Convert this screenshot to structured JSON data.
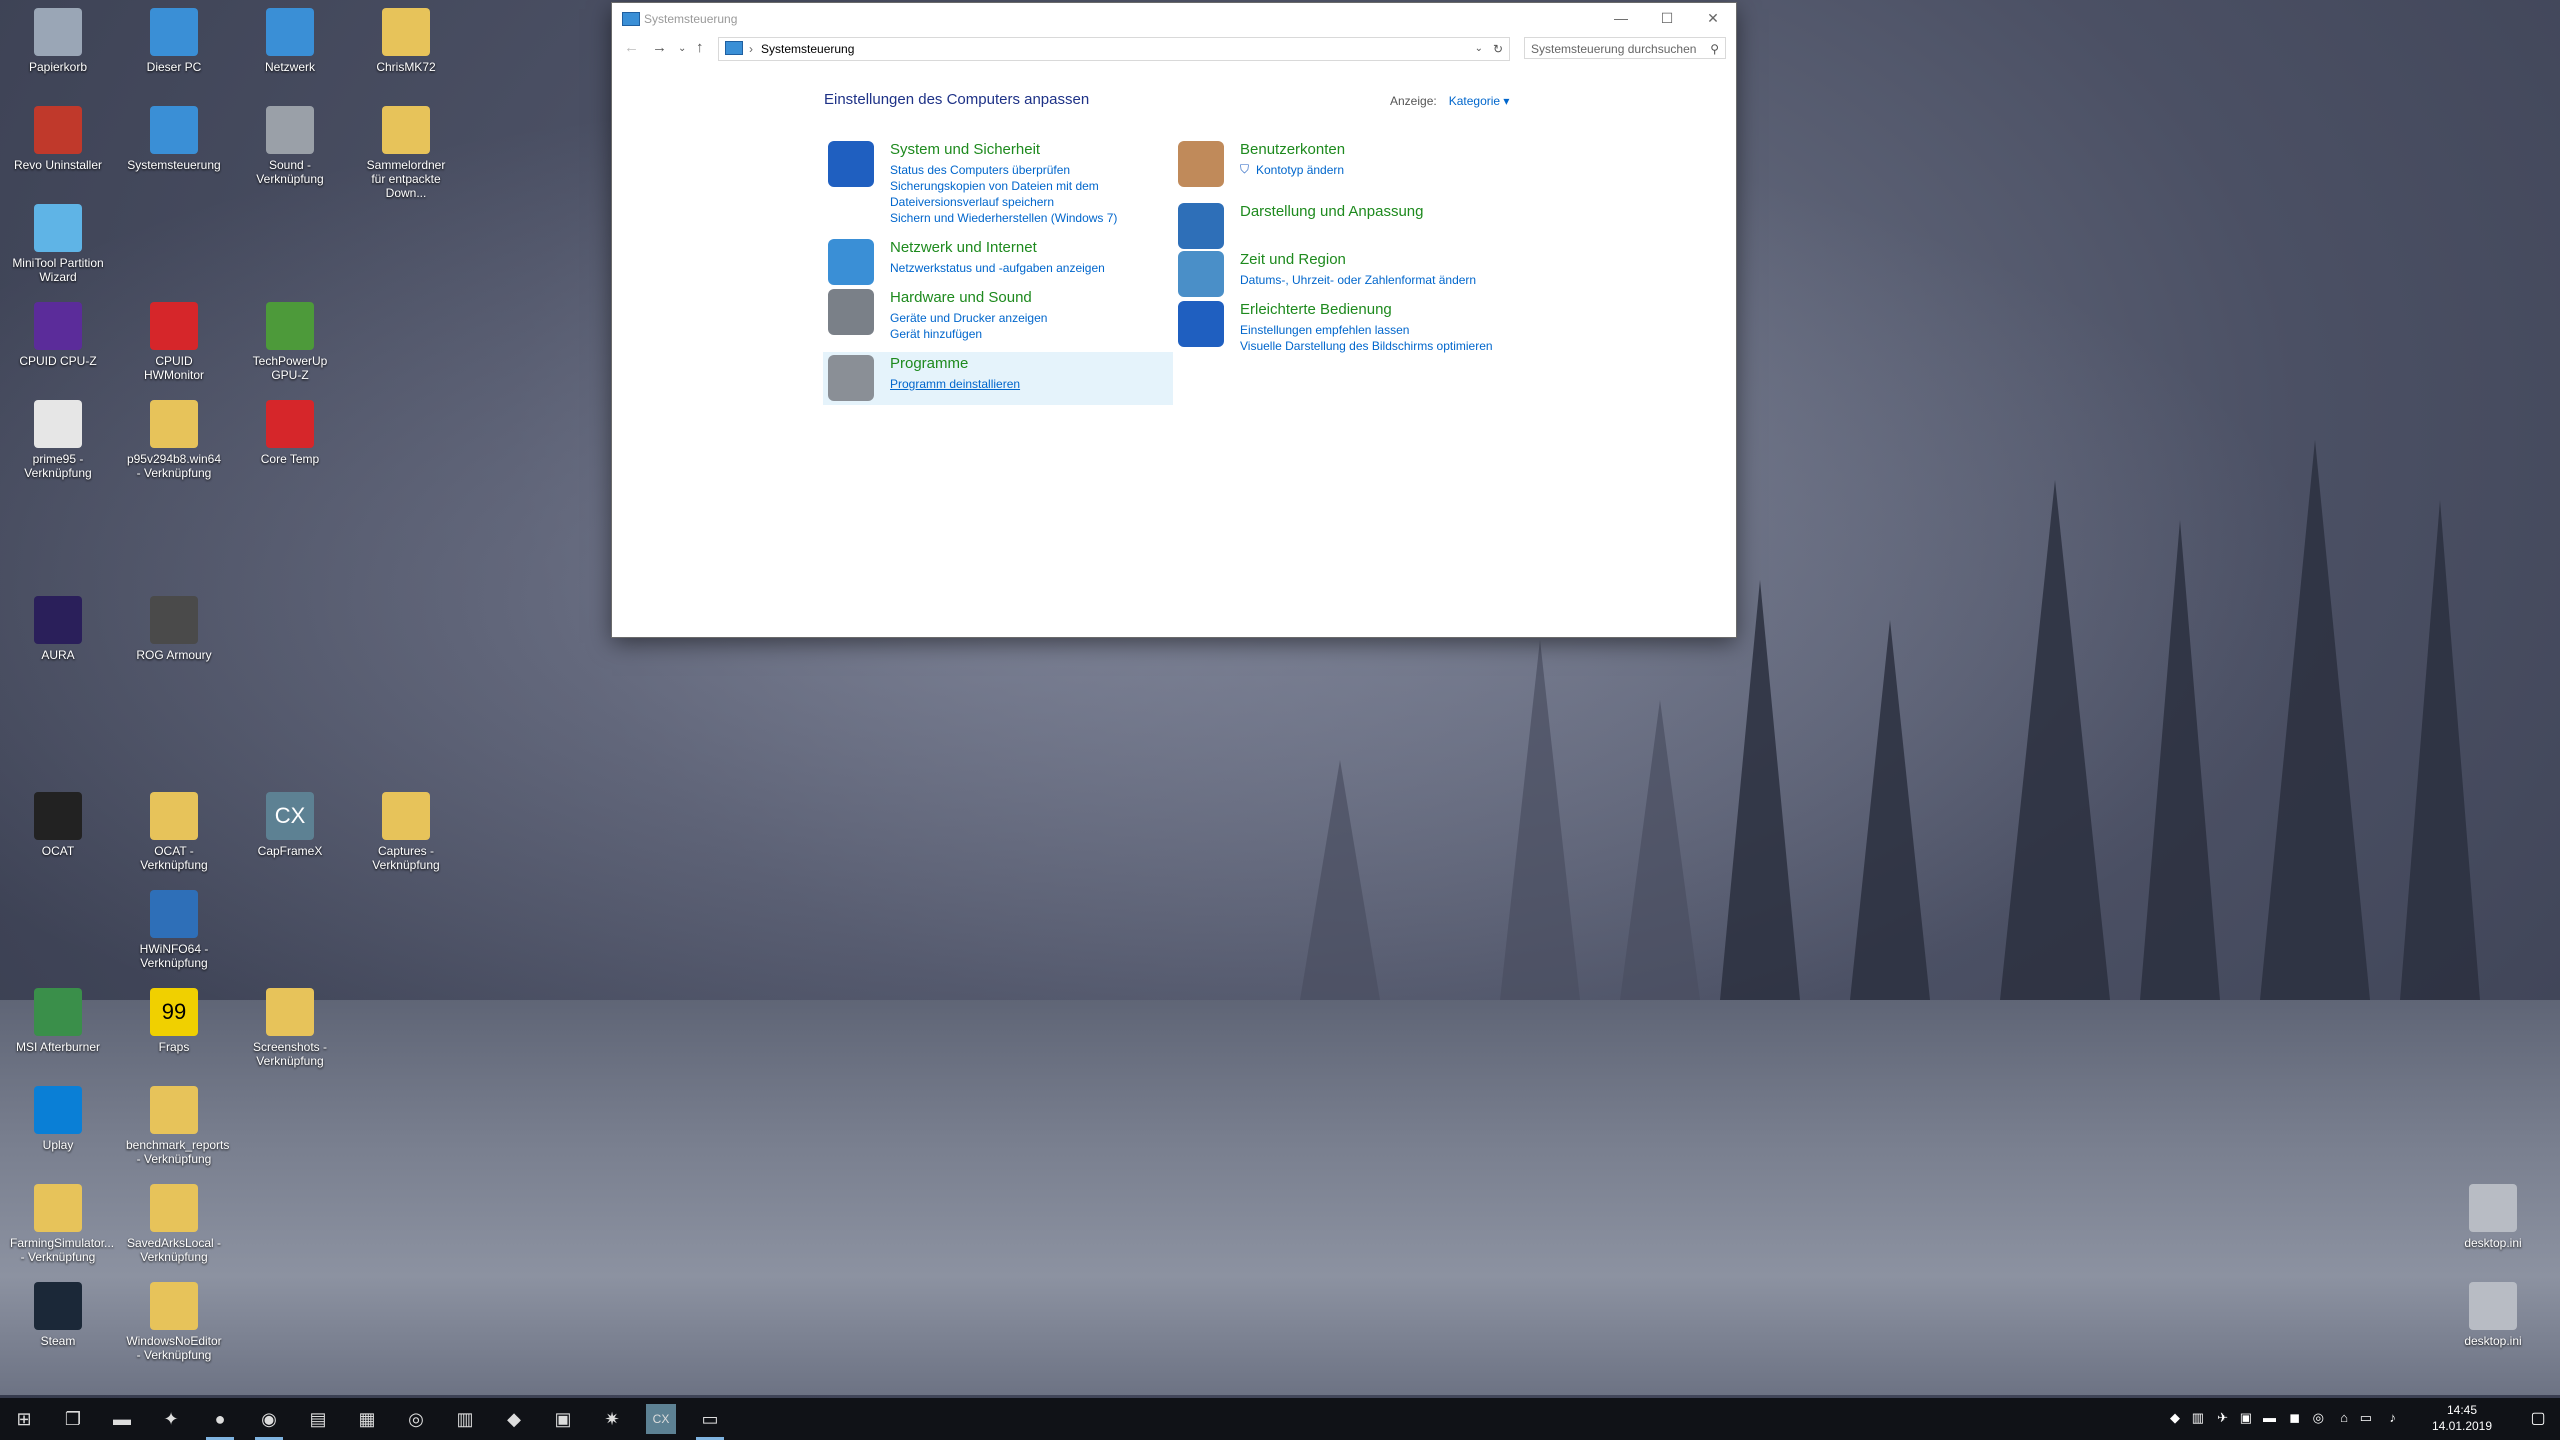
{
  "desktop": {
    "icons": [
      {
        "label": "Papierkorb",
        "icon": "recycle-bin-icon",
        "color": "#9aa6b6"
      },
      {
        "label": "Dieser PC",
        "icon": "computer-icon",
        "color": "#3a8fd6"
      },
      {
        "label": "Netzwerk",
        "icon": "network-icon",
        "color": "#3a8fd6"
      },
      {
        "label": "ChrisMK72",
        "icon": "user-folder-icon",
        "color": "#e7c35a"
      },
      {
        "label": "Revo Uninstaller",
        "icon": "revo-uninstaller-icon",
        "color": "#c0392b"
      },
      {
        "label": "Systemsteuerung",
        "icon": "control-panel-icon",
        "color": "#3a8fd6"
      },
      {
        "label": "Sound - Verknüpfung",
        "icon": "speaker-icon",
        "color": "#9aa0a8"
      },
      {
        "label": "Sammelordner für entpackte Down...",
        "icon": "folder-icon",
        "color": "#e7c35a"
      },
      {
        "label": "MiniTool Partition Wizard",
        "icon": "minitool-icon",
        "color": "#5fb4e6"
      },
      {
        "label": "CPUID CPU-Z",
        "icon": "cpuz-icon",
        "color": "#5b2c9a"
      },
      {
        "label": "CPUID HWMonitor",
        "icon": "hwmonitor-icon",
        "color": "#d6262a"
      },
      {
        "label": "TechPowerUp GPU-Z",
        "icon": "gpuz-icon",
        "color": "#4d9a3a"
      },
      {
        "label": "prime95 - Verknüpfung",
        "icon": "prime95-icon",
        "color": "#e6e6e6"
      },
      {
        "label": "p95v294b8.win64 - Verknüpfung",
        "icon": "folder-icon",
        "color": "#e7c35a"
      },
      {
        "label": "Core Temp",
        "icon": "core-temp-icon",
        "color": "#d6262a"
      },
      {
        "label": "AURA",
        "icon": "aura-icon",
        "color": "#2a1f5a"
      },
      {
        "label": "ROG Armoury",
        "icon": "rog-icon",
        "color": "#4a4a4a"
      },
      {
        "label": "OCAT",
        "icon": "ocat-icon",
        "color": "#222222"
      },
      {
        "label": "OCAT - Verknüpfung",
        "icon": "folder-icon",
        "color": "#e7c35a"
      },
      {
        "label": "CapFrameX",
        "icon": "capframex-icon",
        "color": "#5d8193",
        "text": "CX"
      },
      {
        "label": "Captures - Verknüpfung",
        "icon": "folder-icon",
        "color": "#e7c35a"
      },
      {
        "label": "HWiNFO64 - Verknüpfung",
        "icon": "hwinfo-icon",
        "color": "#2e6fb8"
      },
      {
        "label": "MSI Afterburner",
        "icon": "afterburner-icon",
        "color": "#3a8f4a"
      },
      {
        "label": "Fraps",
        "icon": "fraps-icon",
        "color": "#f0d000",
        "text": "99"
      },
      {
        "label": "Screenshots - Verknüpfung",
        "icon": "folder-icon",
        "color": "#e7c35a"
      },
      {
        "label": "Uplay",
        "icon": "uplay-icon",
        "color": "#0a7fd6"
      },
      {
        "label": "benchmark_reports - Verknüpfung",
        "icon": "folder-icon",
        "color": "#e7c35a"
      },
      {
        "label": "FarmingSimulator... - Verknüpfung",
        "icon": "folder-icon",
        "color": "#e7c35a"
      },
      {
        "label": "SavedArksLocal - Verknüpfung",
        "icon": "folder-icon",
        "color": "#e7c35a"
      },
      {
        "label": "Steam",
        "icon": "steam-icon",
        "color": "#1b2838"
      },
      {
        "label": "WindowsNoEditor - Verknüpfung",
        "icon": "folder-icon",
        "color": "#e7c35a"
      },
      {
        "label": "desktop.ini",
        "icon": "settings-file-icon",
        "color": "#b8bcc4"
      },
      {
        "label": "desktop.ini",
        "icon": "settings-file-icon",
        "color": "#b8bcc4"
      }
    ]
  },
  "window": {
    "title": "Systemsteuerung",
    "breadcrumb": "Systemsteuerung",
    "search_placeholder": "Systemsteuerung durchsuchen",
    "heading": "Einstellungen des Computers anpassen",
    "view_label": "Anzeige:",
    "view_value": "Kategorie",
    "categories_left": [
      {
        "title": "System und Sicherheit",
        "icon": "shield-icon",
        "color": "#1f5fc0",
        "links": [
          "Status des Computers überprüfen",
          "Sicherungskopien von Dateien mit dem",
          "Dateiversionsverlauf speichern",
          "Sichern und Wiederherstellen (Windows 7)"
        ]
      },
      {
        "title": "Netzwerk und Internet",
        "icon": "globe-network-icon",
        "color": "#3a8fd6",
        "links": [
          "Netzwerkstatus und -aufgaben anzeigen"
        ]
      },
      {
        "title": "Hardware und Sound",
        "icon": "printer-icon",
        "color": "#7a8088",
        "links": [
          "Geräte und Drucker anzeigen",
          "Gerät hinzufügen"
        ]
      },
      {
        "title": "Programme",
        "icon": "programs-icon",
        "color": "#8a8f96",
        "links": [
          "Programm deinstallieren"
        ]
      }
    ],
    "categories_right": [
      {
        "title": "Benutzerkonten",
        "icon": "users-icon",
        "color": "#c08a5a",
        "links": [
          "Kontotyp ändern"
        ]
      },
      {
        "title": "Darstellung und Anpassung",
        "icon": "display-icon",
        "color": "#2e6fb8",
        "links": []
      },
      {
        "title": "Zeit und Region",
        "icon": "clock-globe-icon",
        "color": "#4a8fc8",
        "links": [
          "Datums-, Uhrzeit- oder Zahlenformat ändern"
        ]
      },
      {
        "title": "Erleichterte Bedienung",
        "icon": "accessibility-icon",
        "color": "#1f5fc0",
        "links": [
          "Einstellungen empfehlen lassen",
          "Visuelle Darstellung des Bildschirms optimieren"
        ]
      }
    ]
  },
  "taskbar": {
    "items": [
      {
        "name": "start-button",
        "glyph": "⊞",
        "active": false
      },
      {
        "name": "task-view-button",
        "glyph": "❐",
        "active": false
      },
      {
        "name": "file-explorer-button",
        "glyph": "▬",
        "active": false
      },
      {
        "name": "settings-app-button",
        "glyph": "✦",
        "active": false
      },
      {
        "name": "firefox-button",
        "glyph": "●",
        "active": true
      },
      {
        "name": "spotify-button",
        "glyph": "◉",
        "active": true
      },
      {
        "name": "notepad-button",
        "glyph": "▤",
        "active": false
      },
      {
        "name": "calculator-button",
        "glyph": "▦",
        "active": false
      },
      {
        "name": "uplay-taskbar-button",
        "glyph": "◎",
        "active": false
      },
      {
        "name": "hwinfo-taskbar-button",
        "glyph": "▥",
        "active": false
      },
      {
        "name": "hwmonitor-taskbar-button",
        "glyph": "◆",
        "active": false
      },
      {
        "name": "gpuz-taskbar-button",
        "glyph": "▣",
        "active": false
      },
      {
        "name": "ocat-taskbar-button",
        "glyph": "✷",
        "active": false
      },
      {
        "name": "capframex-taskbar-button",
        "glyph": "CX",
        "active": false
      },
      {
        "name": "control-panel-taskbar-button",
        "glyph": "▭",
        "active": true
      }
    ],
    "time": "14:45",
    "date": "14.01.2019"
  }
}
